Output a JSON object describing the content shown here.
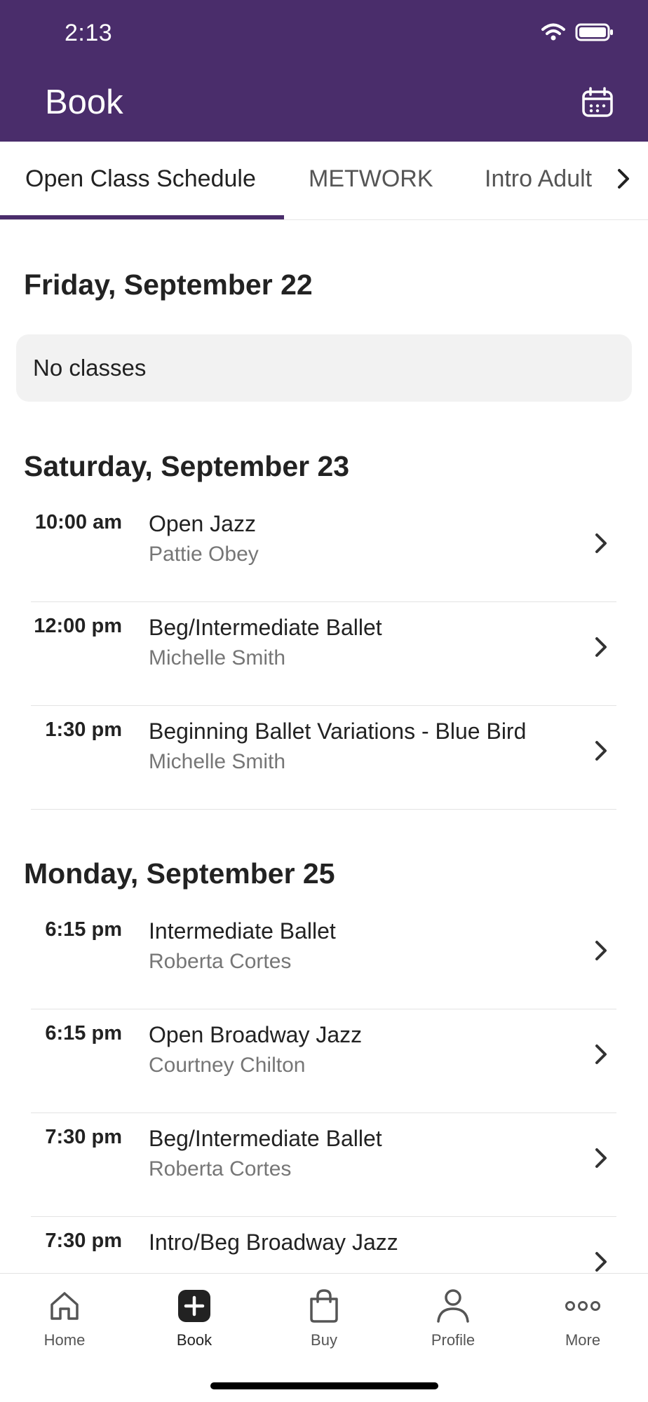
{
  "status_bar": {
    "time": "2:13"
  },
  "header": {
    "title": "Book"
  },
  "tabs": [
    {
      "label": "Open Class Schedule",
      "active": true
    },
    {
      "label": "METWORK",
      "active": false
    },
    {
      "label": "Intro Adult (",
      "active": false
    }
  ],
  "days": [
    {
      "heading": "Friday, September 22",
      "empty_text": "No classes",
      "classes": []
    },
    {
      "heading": "Saturday, September 23",
      "classes": [
        {
          "time": "10:00 am",
          "name": "Open Jazz",
          "instructor": "Pattie Obey"
        },
        {
          "time": "12:00 pm",
          "name": "Beg/Intermediate Ballet",
          "instructor": "Michelle Smith"
        },
        {
          "time": "1:30 pm",
          "name": "Beginning Ballet Variations - Blue Bird",
          "instructor": "Michelle Smith"
        }
      ]
    },
    {
      "heading": "Monday, September 25",
      "classes": [
        {
          "time": "6:15 pm",
          "name": "Intermediate Ballet",
          "instructor": "Roberta Cortes"
        },
        {
          "time": "6:15 pm",
          "name": "Open Broadway Jazz",
          "instructor": "Courtney Chilton"
        },
        {
          "time": "7:30 pm",
          "name": "Beg/Intermediate Ballet",
          "instructor": "Roberta Cortes"
        },
        {
          "time": "7:30 pm",
          "name": "Intro/Beg Broadway Jazz",
          "instructor": ""
        }
      ]
    }
  ],
  "bottom_nav": [
    {
      "label": "Home",
      "icon": "home-icon",
      "active": false
    },
    {
      "label": "Book",
      "icon": "plus-square-icon",
      "active": true
    },
    {
      "label": "Buy",
      "icon": "shopping-bag-icon",
      "active": false
    },
    {
      "label": "Profile",
      "icon": "person-icon",
      "active": false
    },
    {
      "label": "More",
      "icon": "more-dots-icon",
      "active": false
    }
  ],
  "colors": {
    "brand": "#4a2d6b",
    "muted_text": "#767676",
    "empty_bg": "#f2f2f2"
  }
}
